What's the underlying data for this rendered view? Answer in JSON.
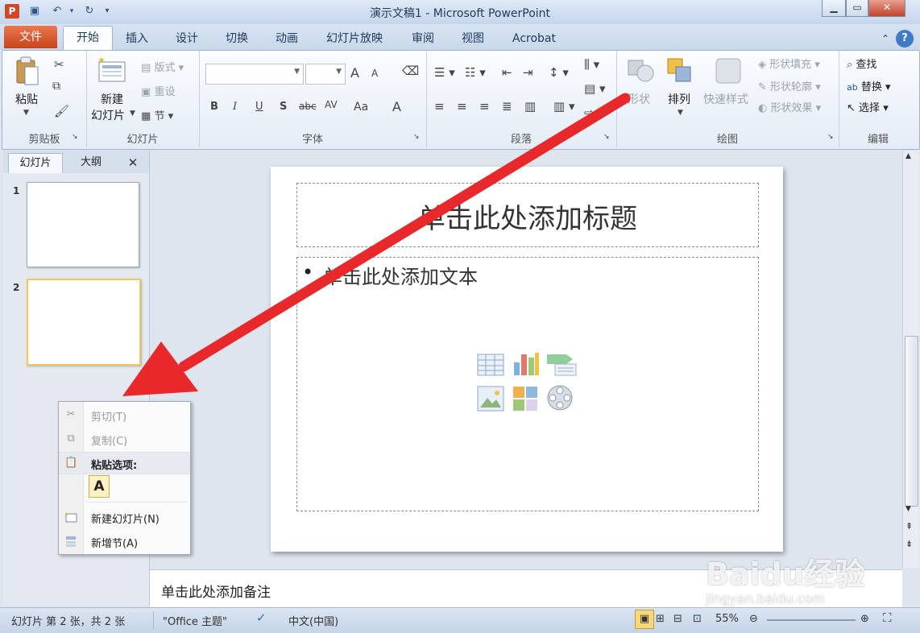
{
  "window": {
    "title": "演示文稿1 - Microsoft PowerPoint",
    "app_icon_letter": "P"
  },
  "tabs": [
    "文件",
    "开始",
    "插入",
    "设计",
    "切换",
    "动画",
    "幻灯片放映",
    "审阅",
    "视图",
    "Acrobat"
  ],
  "ribbon": {
    "clipboard": {
      "paste": "粘贴",
      "label": "剪贴板"
    },
    "slides": {
      "new_slide_line1": "新建",
      "new_slide_line2": "幻灯片",
      "layout": "版式",
      "reset": "重设",
      "section": "节",
      "label": "幻灯片"
    },
    "font": {
      "label": "字体",
      "bold": "B",
      "italic": "I",
      "underline": "U",
      "shadow": "S",
      "strike": "abc",
      "spacing": "AV",
      "case": "Aa",
      "color": "A",
      "grow": "A",
      "shrink": "A"
    },
    "paragraph": {
      "label": "段落"
    },
    "drawing": {
      "shapes": "形状",
      "arrange": "排列",
      "quick_styles": "快速样式",
      "fill": "形状填充",
      "outline": "形状轮廓",
      "effects": "形状效果",
      "label": "绘图"
    },
    "editing": {
      "find": "查找",
      "replace": "替换",
      "select": "选择",
      "label": "编辑"
    }
  },
  "left_panel": {
    "tab_slides": "幻灯片",
    "tab_outline": "大纲",
    "close": "✕",
    "thumbs": [
      "1",
      "2"
    ]
  },
  "slide": {
    "title_placeholder": "单击此处添加标题",
    "body_placeholder": "单击此处添加文本",
    "bullet": "•"
  },
  "notes_placeholder": "单击此处添加备注",
  "context_menu": {
    "cut": "剪切(T)",
    "copy": "复制(C)",
    "paste_options": "粘贴选项:",
    "paste_keep_text": "A",
    "new_slide": "新建幻灯片(N)",
    "new_section": "新增节(A)"
  },
  "statusbar": {
    "slide_info": "幻灯片 第 2 张，共 2 张",
    "theme": "\"Office 主题\"",
    "language": "中文(中国)",
    "zoom": "55%"
  },
  "watermark": {
    "brand": "Baidu经验",
    "url": "jingyan.baidu.com"
  },
  "colors": {
    "accent_file_tab": "#d24726",
    "arrow": "#e8282b"
  }
}
